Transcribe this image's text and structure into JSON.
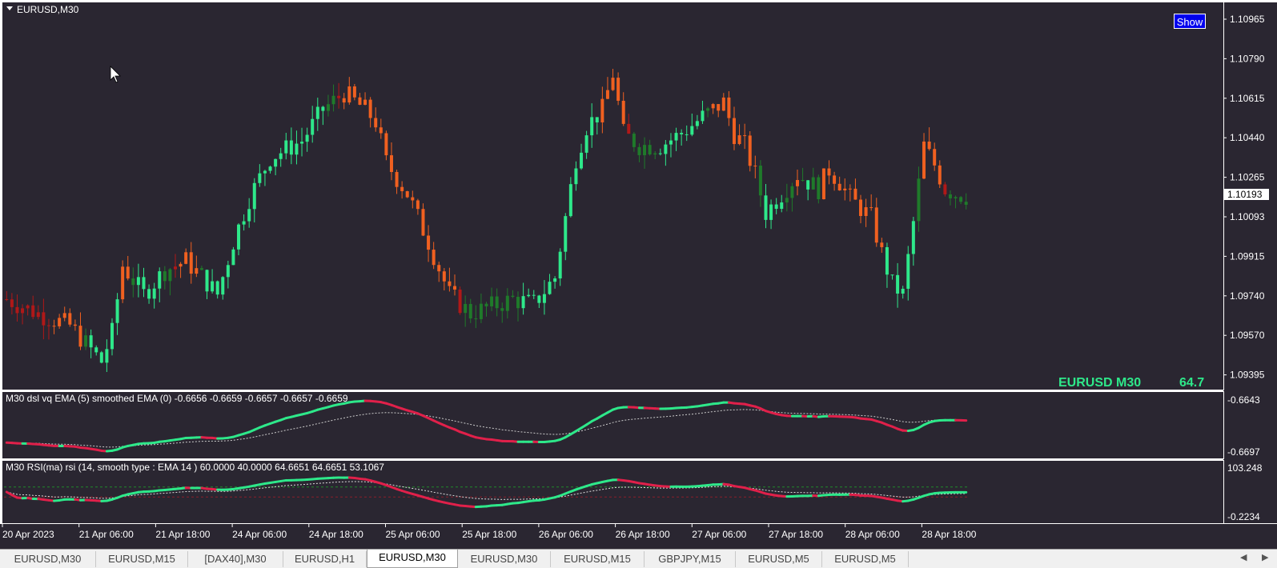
{
  "window": {
    "symbol_title": "EURUSD,M30"
  },
  "show_button": "Show",
  "colors": {
    "background": "#2a2631",
    "bull": "#2ee88a",
    "bull_dark": "#1f7a2a",
    "bear": "#f06020",
    "bear_dark": "#b01818",
    "dsl_up": "#2ee88a",
    "dsl_down": "#e0204a"
  },
  "main_panel": {
    "price_labels": [
      "1.10965",
      "1.10790",
      "1.10615",
      "1.10440",
      "1.10265",
      "1.10093",
      "1.09915",
      "1.09740",
      "1.09570",
      "1.09395"
    ],
    "current_price": "1.10193",
    "watermark_pair": "EURUSD M30",
    "watermark_value": "64.7"
  },
  "indicator1": {
    "title": "M30 dsl vq  EMA (5)  smoothed EMA (0) -0.6656 -0.6659 -0.6657 -0.6657 -0.6659",
    "scale_top": "-0.6643",
    "scale_bottom": "-0.6697"
  },
  "indicator2": {
    "title": "M30 RSI(ma) rsi (14, smooth type : EMA  14 ) 60.0000 40.0000 64.6651 64.6651 53.1067",
    "scale_top": "103.248",
    "scale_bottom": "-0.2234"
  },
  "time_labels": [
    "20 Apr 2023",
    "21 Apr 06:00",
    "21 Apr 18:00",
    "24 Apr 06:00",
    "24 Apr 18:00",
    "25 Apr 06:00",
    "25 Apr 18:00",
    "26 Apr 06:00",
    "26 Apr 18:00",
    "27 Apr 06:00",
    "27 Apr 18:00",
    "28 Apr 06:00",
    "28 Apr 18:00"
  ],
  "tabs": [
    "EURUSD,M30",
    "EURUSD,M15",
    "[DAX40],M30",
    "EURUSD,H1",
    "EURUSD,M30",
    "EURUSD,M30",
    "EURUSD,M15",
    "GBPJPY,M15",
    "EURUSD,M5",
    "EURUSD,M5"
  ],
  "active_tab_index": 4,
  "chart_data": {
    "type": "candlestick",
    "title": "EURUSD,M30",
    "ylim": [
      1.0939,
      1.1099
    ],
    "current_price": 1.10193,
    "x": [
      "20 Apr 2023",
      "21 Apr 06:00",
      "21 Apr 18:00",
      "24 Apr 06:00",
      "24 Apr 18:00",
      "25 Apr 06:00",
      "25 Apr 18:00",
      "26 Apr 06:00",
      "26 Apr 18:00",
      "27 Apr 06:00",
      "27 Apr 18:00",
      "28 Apr 06:00",
      "28 Apr 18:00"
    ],
    "price_path": [
      [
        0,
        1.0976
      ],
      [
        6,
        1.097
      ],
      [
        12,
        1.0965
      ],
      [
        16,
        1.0955
      ],
      [
        18,
        1.095
      ],
      [
        20,
        1.0962
      ],
      [
        22,
        1.099
      ],
      [
        26,
        1.0978
      ],
      [
        30,
        1.0988
      ],
      [
        34,
        1.0992
      ],
      [
        38,
        1.0983
      ],
      [
        40,
        1.0978
      ],
      [
        43,
        1.1
      ],
      [
        46,
        1.1018
      ],
      [
        50,
        1.1035
      ],
      [
        56,
        1.1042
      ],
      [
        60,
        1.1055
      ],
      [
        64,
        1.1062
      ],
      [
        68,
        1.1055
      ],
      [
        70,
        1.105
      ],
      [
        72,
        1.1033
      ],
      [
        76,
        1.102
      ],
      [
        80,
        1.1
      ],
      [
        84,
        1.0978
      ],
      [
        88,
        1.097
      ],
      [
        92,
        1.0973
      ],
      [
        96,
        1.0976
      ],
      [
        100,
        1.0974
      ],
      [
        104,
        1.0985
      ],
      [
        106,
        1.101
      ],
      [
        108,
        1.1035
      ],
      [
        110,
        1.1048
      ],
      [
        113,
        1.1055
      ],
      [
        115,
        1.107
      ],
      [
        117,
        1.1045
      ],
      [
        120,
        1.104
      ],
      [
        124,
        1.104
      ],
      [
        128,
        1.1045
      ],
      [
        132,
        1.1052
      ],
      [
        136,
        1.1058
      ],
      [
        138,
        1.1045
      ],
      [
        140,
        1.104
      ],
      [
        142,
        1.1028
      ],
      [
        144,
        1.1012
      ],
      [
        147,
        1.102
      ],
      [
        150,
        1.1028
      ],
      [
        154,
        1.1022
      ],
      [
        156,
        1.103
      ],
      [
        158,
        1.1025
      ],
      [
        160,
        1.1018
      ],
      [
        164,
        1.101
      ],
      [
        166,
        1.0995
      ],
      [
        168,
        1.0982
      ],
      [
        170,
        1.0978
      ],
      [
        172,
        1.1008
      ],
      [
        174,
        1.104
      ],
      [
        176,
        1.1032
      ],
      [
        178,
        1.1022
      ],
      [
        180,
        1.102
      ],
      [
        182,
        1.1019
      ]
    ],
    "series": [
      {
        "name": "dsl vq",
        "values": [
          -0.6656,
          -0.6659,
          -0.6657,
          -0.6657,
          -0.6659
        ]
      },
      {
        "name": "RSI(ma)",
        "values": [
          60.0,
          40.0,
          64.6651,
          64.6651,
          53.1067
        ]
      }
    ]
  }
}
